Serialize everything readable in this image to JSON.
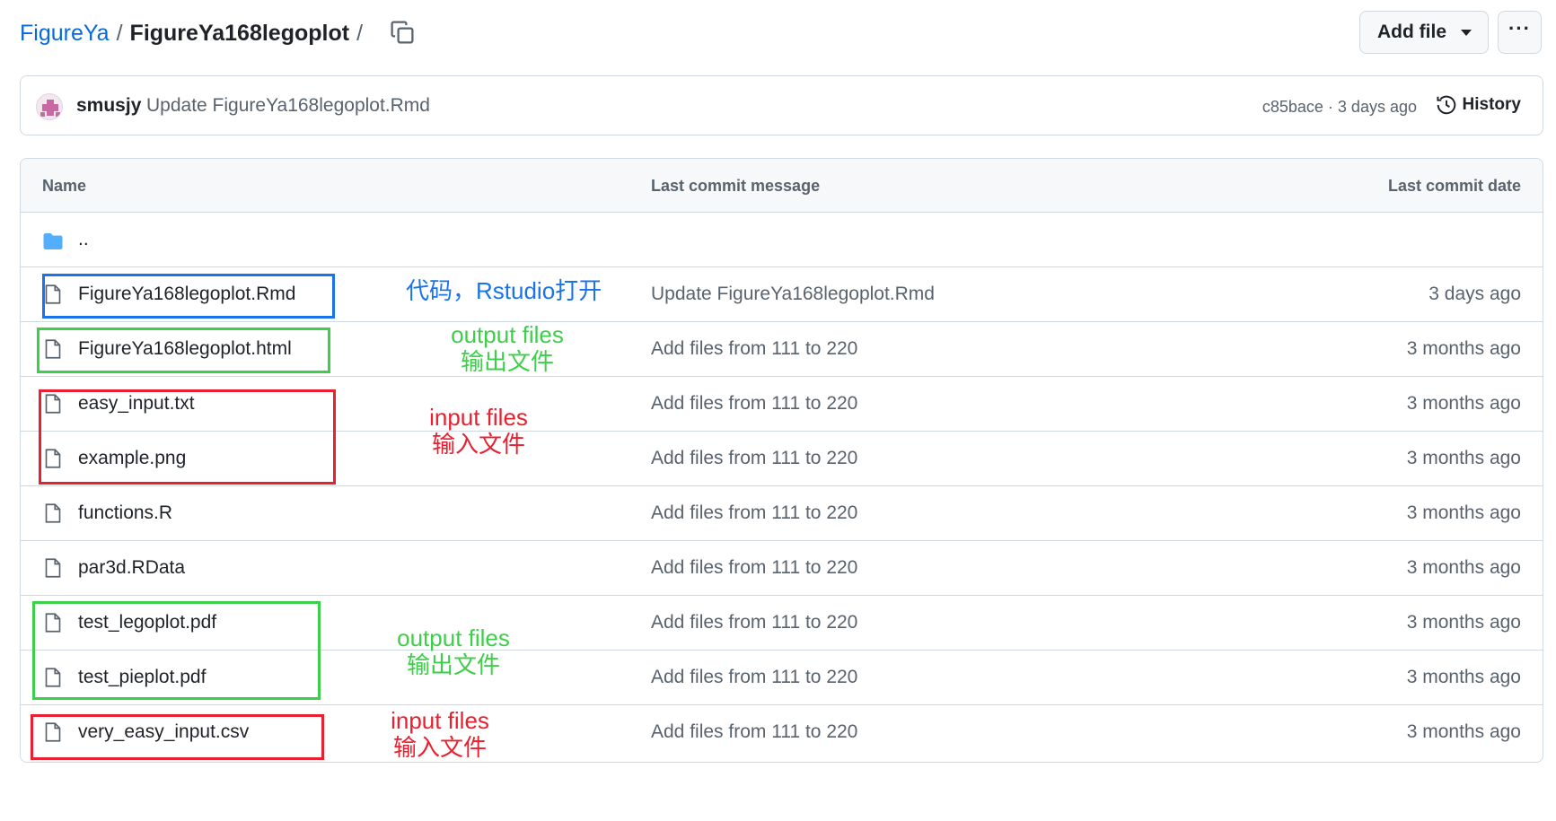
{
  "breadcrumb": {
    "repo": "FigureYa",
    "separator": "/",
    "folder": "FigureYa168legoplot",
    "trailing": "/"
  },
  "header": {
    "add_file_label": "Add file",
    "more_label": "···"
  },
  "commit": {
    "author": "smusjy",
    "message": "Update FigureYa168legoplot.Rmd",
    "meta": "c85bace · 3 days ago",
    "history_label": "History"
  },
  "table": {
    "columns": {
      "name": "Name",
      "message": "Last commit message",
      "date": "Last commit date"
    },
    "parent": "..",
    "rows": [
      {
        "name": "FigureYa168legoplot.Rmd",
        "message": "Update FigureYa168legoplot.Rmd",
        "date": "3 days ago"
      },
      {
        "name": "FigureYa168legoplot.html",
        "message": "Add files from 111 to 220",
        "date": "3 months ago"
      },
      {
        "name": "easy_input.txt",
        "message": "Add files from 111 to 220",
        "date": "3 months ago"
      },
      {
        "name": "example.png",
        "message": "Add files from 111 to 220",
        "date": "3 months ago"
      },
      {
        "name": "functions.R",
        "message": "Add files from 111 to 220",
        "date": "3 months ago"
      },
      {
        "name": "par3d.RData",
        "message": "Add files from 111 to 220",
        "date": "3 months ago"
      },
      {
        "name": "test_legoplot.pdf",
        "message": "Add files from 111 to 220",
        "date": "3 months ago"
      },
      {
        "name": "test_pieplot.pdf",
        "message": "Add files from 111 to 220",
        "date": "3 months ago"
      },
      {
        "name": "very_easy_input.csv",
        "message": "Add files from 111 to 220",
        "date": "3 months ago"
      }
    ]
  },
  "annotations": {
    "code": {
      "text": "代码，Rstudio打开",
      "color": "#1a73e8"
    },
    "output1": {
      "line1": "output files",
      "line2": "输出文件",
      "color": "#3ecf4a"
    },
    "input1": {
      "line1": "input files",
      "line2": "输入文件",
      "color": "#e8202f"
    },
    "output2": {
      "line1": "output files",
      "line2": "输出文件",
      "color": "#3ecf4a"
    },
    "input2": {
      "line1": "input files",
      "line2": "输入文件",
      "color": "#e8202f"
    }
  },
  "colors": {
    "link": "#0969da",
    "folder_icon": "#54aeff",
    "border": "#d1d9e0",
    "muted_text": "#59636e"
  }
}
